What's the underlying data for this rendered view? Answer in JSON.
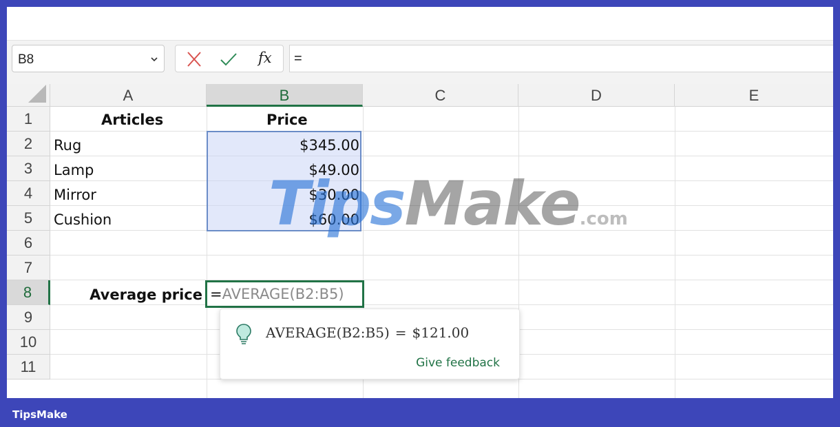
{
  "name_box": {
    "value": "B8"
  },
  "formula_bar": {
    "fx_label": "fx",
    "value": "="
  },
  "columns": [
    "A",
    "B",
    "C",
    "D",
    "E"
  ],
  "rows": [
    "1",
    "2",
    "3",
    "4",
    "5",
    "6",
    "7",
    "8",
    "9",
    "10",
    "11"
  ],
  "cells": {
    "A1": "Articles",
    "B1": "Price",
    "A2": "Rug",
    "B2": "$345.00",
    "A3": "Lamp",
    "B3": "$49.00",
    "A4": "Mirror",
    "B4": "$30.00",
    "A5": "Cushion",
    "B5": "$60.00",
    "A8": "Average price"
  },
  "active_cell": {
    "prefix": "=",
    "formula": "AVERAGE(B2:B5)"
  },
  "tooltip": {
    "expression": "AVERAGE(B2:B5)",
    "equals": "=",
    "result": "$121.00",
    "feedback_label": "Give feedback"
  },
  "watermark": {
    "part1": "Tips",
    "part2": "Make",
    "suffix": ".com"
  },
  "footer": {
    "brand": "TipsMake"
  },
  "colors": {
    "accent_green": "#217346",
    "selection_border": "#6a8cc7",
    "frame_blue": "#3d46b9"
  }
}
